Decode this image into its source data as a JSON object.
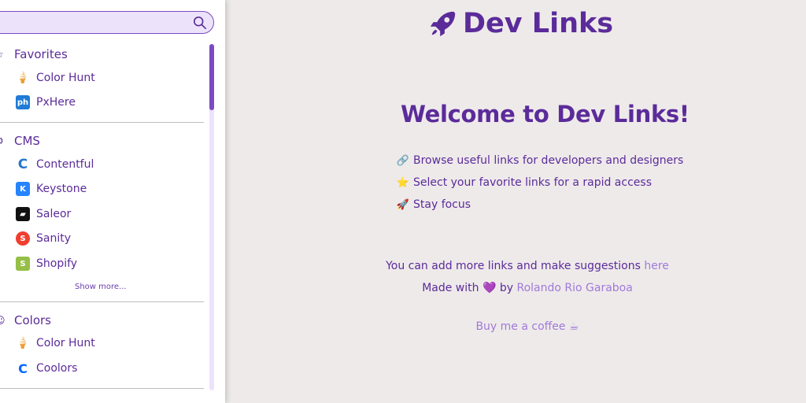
{
  "sidebar": {
    "search": {
      "placeholder": "",
      "value": ""
    },
    "sections": [
      {
        "title": "Favorites",
        "icon": "star-outline-icon",
        "items": [
          {
            "label": "Color Hunt",
            "icon": "color-hunt-icon",
            "color": "#e8a13a"
          },
          {
            "label": "PxHere",
            "icon": "pxhere-icon",
            "color": "#1f7bd6"
          }
        ]
      },
      {
        "title": "CMS",
        "icon": "gear-icon",
        "items": [
          {
            "label": "Contentful",
            "icon": "contentful-icon",
            "color": "#2478cc"
          },
          {
            "label": "Keystone",
            "icon": "keystone-icon",
            "color": "#2684ff"
          },
          {
            "label": "Saleor",
            "icon": "saleor-icon",
            "color": "#111111"
          },
          {
            "label": "Sanity",
            "icon": "sanity-icon",
            "color": "#f03e2f"
          },
          {
            "label": "Shopify",
            "icon": "shopify-icon",
            "color": "#95bf47"
          }
        ],
        "show_more": "Show more..."
      },
      {
        "title": "Colors",
        "icon": "palette-icon",
        "items": [
          {
            "label": "Color Hunt",
            "icon": "color-hunt-icon",
            "color": "#e8a13a"
          },
          {
            "label": "Coolors",
            "icon": "coolors-icon",
            "color": "#0066ff"
          }
        ]
      }
    ]
  },
  "main": {
    "brand_title": "Dev Links",
    "brand_icon": "rocket-icon",
    "welcome": "Welcome to Dev Links!",
    "lines": [
      {
        "emoji": "🔗",
        "text": "Browse useful links for developers and designers"
      },
      {
        "emoji": "⭐",
        "text": "Select your favorite links for a rapid access"
      },
      {
        "emoji": "🚀",
        "text": "Stay focus"
      }
    ],
    "suggest_text": "You can add more links and make suggestions ",
    "suggest_link": "here",
    "made_with_prefix": "Made with ",
    "made_with_heart": "💜",
    "made_with_by": " by ",
    "author_link": "Rolando Rio Garaboa",
    "coffee_link": "Buy me a coffee ☕"
  },
  "colors": {
    "accent": "#5b2b9a",
    "link": "#a07ad8",
    "background": "#eeeaea"
  }
}
